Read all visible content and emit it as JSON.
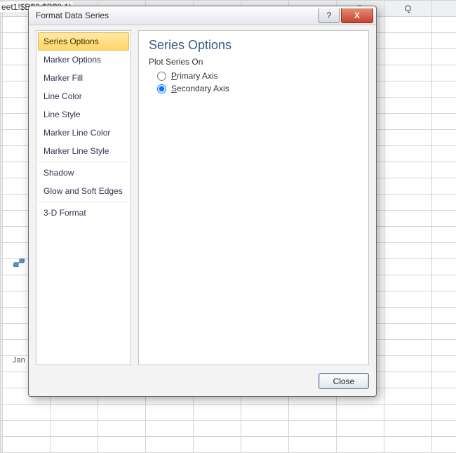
{
  "background": {
    "formula_fragment": "eet1!$B$3:$B$8,1)",
    "columns": [
      "",
      "",
      "",
      "",
      "",
      "",
      "",
      "P",
      "Q",
      ""
    ],
    "axis_label": "Jan"
  },
  "dialog": {
    "title": "Format Data Series",
    "help_symbol": "?",
    "close_symbol": "X",
    "close_button": "Close"
  },
  "sidebar": {
    "items": [
      "Series Options",
      "Marker Options",
      "Marker Fill",
      "Line Color",
      "Line Style",
      "Marker Line Color",
      "Marker Line Style",
      "Shadow",
      "Glow and Soft Edges",
      "3-D Format"
    ],
    "selected_index": 0
  },
  "panel": {
    "heading": "Series Options",
    "group": "Plot Series On",
    "options": {
      "primary": "Primary Axis",
      "secondary": "Secondary Axis"
    },
    "selected": "secondary"
  }
}
